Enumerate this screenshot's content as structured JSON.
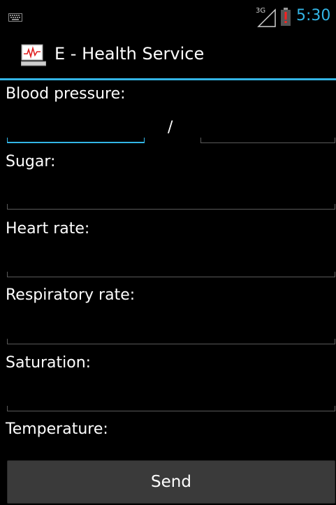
{
  "status_bar": {
    "network_type": "3G",
    "time": "5:30",
    "time_color": "#33b5e5",
    "battery_alert": "!",
    "icons": [
      "keyboard-icon",
      "signal-icon",
      "battery-alert-icon"
    ]
  },
  "action_bar": {
    "title": "E - Health Service",
    "icon": "heart-monitor-icon",
    "accent_color": "#33b5e5"
  },
  "form": {
    "blood_pressure": {
      "label": "Blood pressure:",
      "separator": "/",
      "systolic_value": "",
      "diastolic_value": ""
    },
    "sugar": {
      "label": "Sugar:",
      "value": ""
    },
    "heart_rate": {
      "label": "Heart rate:",
      "value": ""
    },
    "respiratory_rate": {
      "label": "Respiratory rate:",
      "value": ""
    },
    "saturation": {
      "label": "Saturation:",
      "value": ""
    },
    "temperature": {
      "label": "Temperature:"
    },
    "send_label": "Send"
  }
}
